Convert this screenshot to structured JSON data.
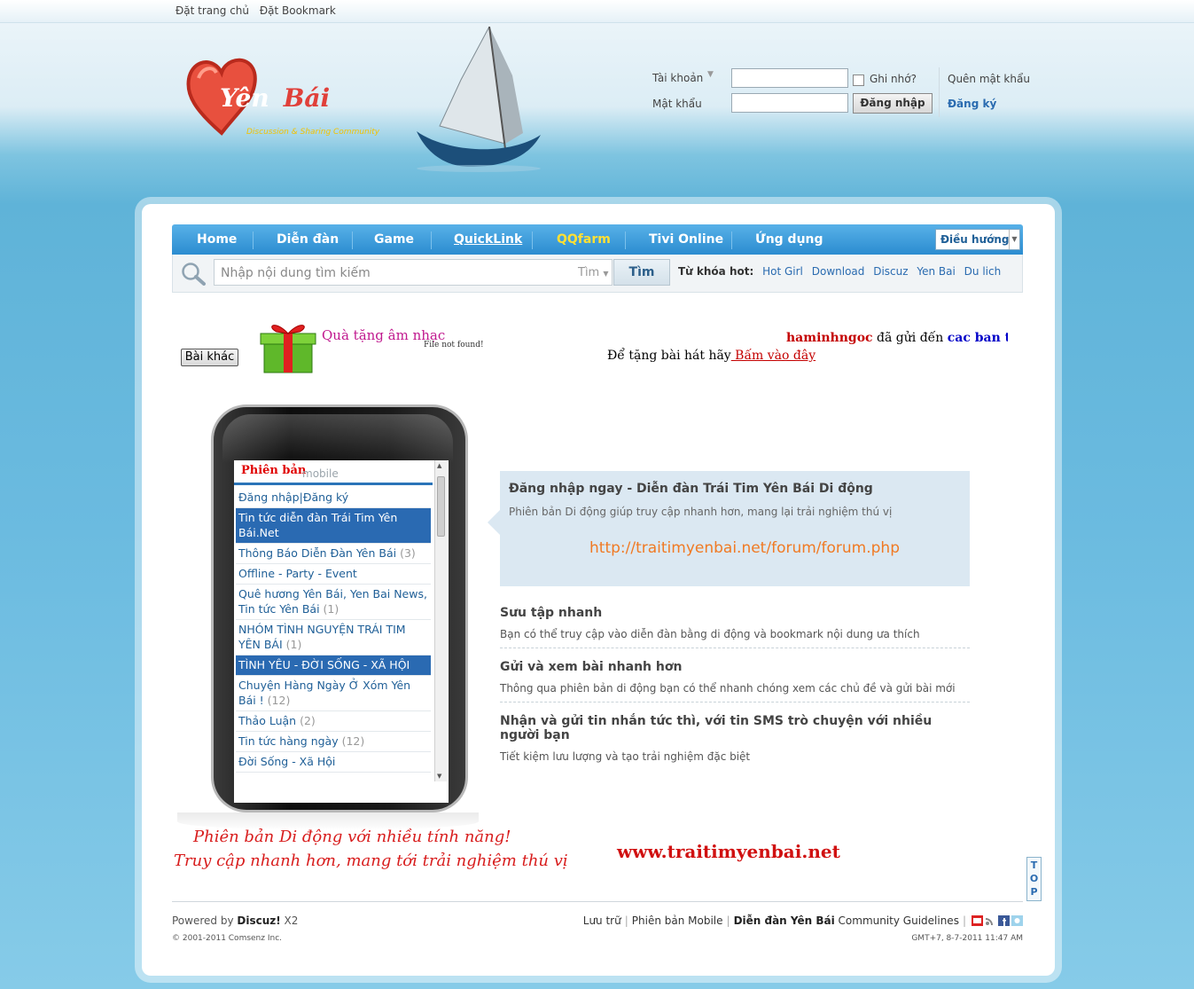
{
  "topbar": {
    "set_home": "Đặt trang chủ",
    "bookmark": "Đặt Bookmark"
  },
  "logo": {
    "name_1": "Yên",
    "name_2": "Bái",
    "slogan": "Discussion & Sharing Community"
  },
  "login": {
    "account_label": "Tài khoản",
    "password_label": "Mật khẩu",
    "remember": "Ghi nhớ?",
    "forgot": "Quên mật khẩu",
    "login_button": "Đăng nhập",
    "register": "Đăng ký"
  },
  "nav": {
    "items": [
      "Home",
      "Diễn đàn",
      "Game",
      "QuickLink",
      "QQfarm",
      "Tivi Online",
      "Ứng dụng"
    ],
    "dropdown": "Điều hướng"
  },
  "search": {
    "placeholder": "Nhập nội dung tìm kiếm",
    "scope": "Tìm",
    "button": "Tìm",
    "hot_label": "Từ khóa hot:",
    "hot": [
      "Hot Girl",
      "Download",
      "Discuz",
      "Yen Bai",
      "Du lich"
    ]
  },
  "music": {
    "other_button": "Bài khác",
    "gift_title": "Quà tặng âm nhạc",
    "not_found": "File not found!",
    "marquee_user": "haminhngoc",
    "marquee_text": " đã gửi đến ",
    "marquee_target": "cac ban trong d",
    "give_text": "Để tặng bài hát hãy",
    "give_link": " Bấm vào đây"
  },
  "phone": {
    "header_title": "Phiên bản",
    "header_sub": "mobile",
    "rows": [
      {
        "label": "Đăng nhập|Đăng ký",
        "count": "",
        "highlight": false
      },
      {
        "label": "Tin tức diễn đàn Trái Tim Yên Bái.Net",
        "count": "",
        "highlight": true
      },
      {
        "label": "Thông Báo Diễn Đàn Yên Bái ",
        "count": "(3)",
        "highlight": false
      },
      {
        "label": "Offline - Party - Event",
        "count": "",
        "highlight": false
      },
      {
        "label": "Quê hương Yên Bái, Yen Bai News, Tin tức Yên Bái ",
        "count": "(1)",
        "highlight": false
      },
      {
        "label": "NHÓM TÌNH NGUYỆN TRÁI TIM YÊN BÁI ",
        "count": "(1)",
        "highlight": false
      },
      {
        "label": "TÌNH YÊU - ĐỜI SỐNG - XÃ HỘI",
        "count": "",
        "highlight": true
      },
      {
        "label": "Chuyện Hàng Ngày Ở Xóm Yên Bái ! ",
        "count": "(12)",
        "highlight": false
      },
      {
        "label": "Thảo Luận ",
        "count": "(2)",
        "highlight": false
      },
      {
        "label": "Tin tức hàng ngày ",
        "count": "(12)",
        "highlight": false
      },
      {
        "label": "Đời Sống - Xã Hội",
        "count": "",
        "highlight": false
      }
    ]
  },
  "script": {
    "line1": "Phiên bản Di động với nhiều tính năng!",
    "line2": "Truy cập nhanh hơn, mang tới trải nghiệm thú vị"
  },
  "callout": {
    "title": "Đăng nhập ngay - Diễn đàn Trái Tim Yên Bái Di động",
    "subtitle": "Phiên bản Di động giúp truy cập nhanh hơn, mang lại trải nghiệm thú vị",
    "url": "http://traitimyenbai.net/forum/forum.php"
  },
  "features": [
    {
      "title": "Sưu tập nhanh",
      "desc": "Bạn có thể truy cập vào diễn đàn bằng di động và bookmark nội dung ưa thích"
    },
    {
      "title": "Gửi và xem bài nhanh hơn",
      "desc": "Thông qua phiên bản di động bạn có thể nhanh chóng xem các chủ đề và gửi bài mới"
    },
    {
      "title": "Nhận và gửi tin nhắn tức thì, với tin SMS trò chuyện với nhiều người bạn",
      "desc": "Tiết kiệm lưu lượng và tạo trải nghiệm đặc biệt"
    }
  ],
  "site_url": "www.traitimyenbai.net",
  "top_button": [
    "T",
    "O",
    "P"
  ],
  "footer": {
    "powered": "Powered by ",
    "discuz": "Discuz!",
    "version": " X2",
    "copyright": "© 2001-2011 Comsenz Inc.",
    "archive": "Lưu trữ",
    "mobile": "Phiên bản Mobile",
    "forum": "Diễn đàn Yên Bái",
    "guidelines": " Community Guidelines",
    "time": "GMT+7, 8-7-2011 11:47 AM"
  }
}
